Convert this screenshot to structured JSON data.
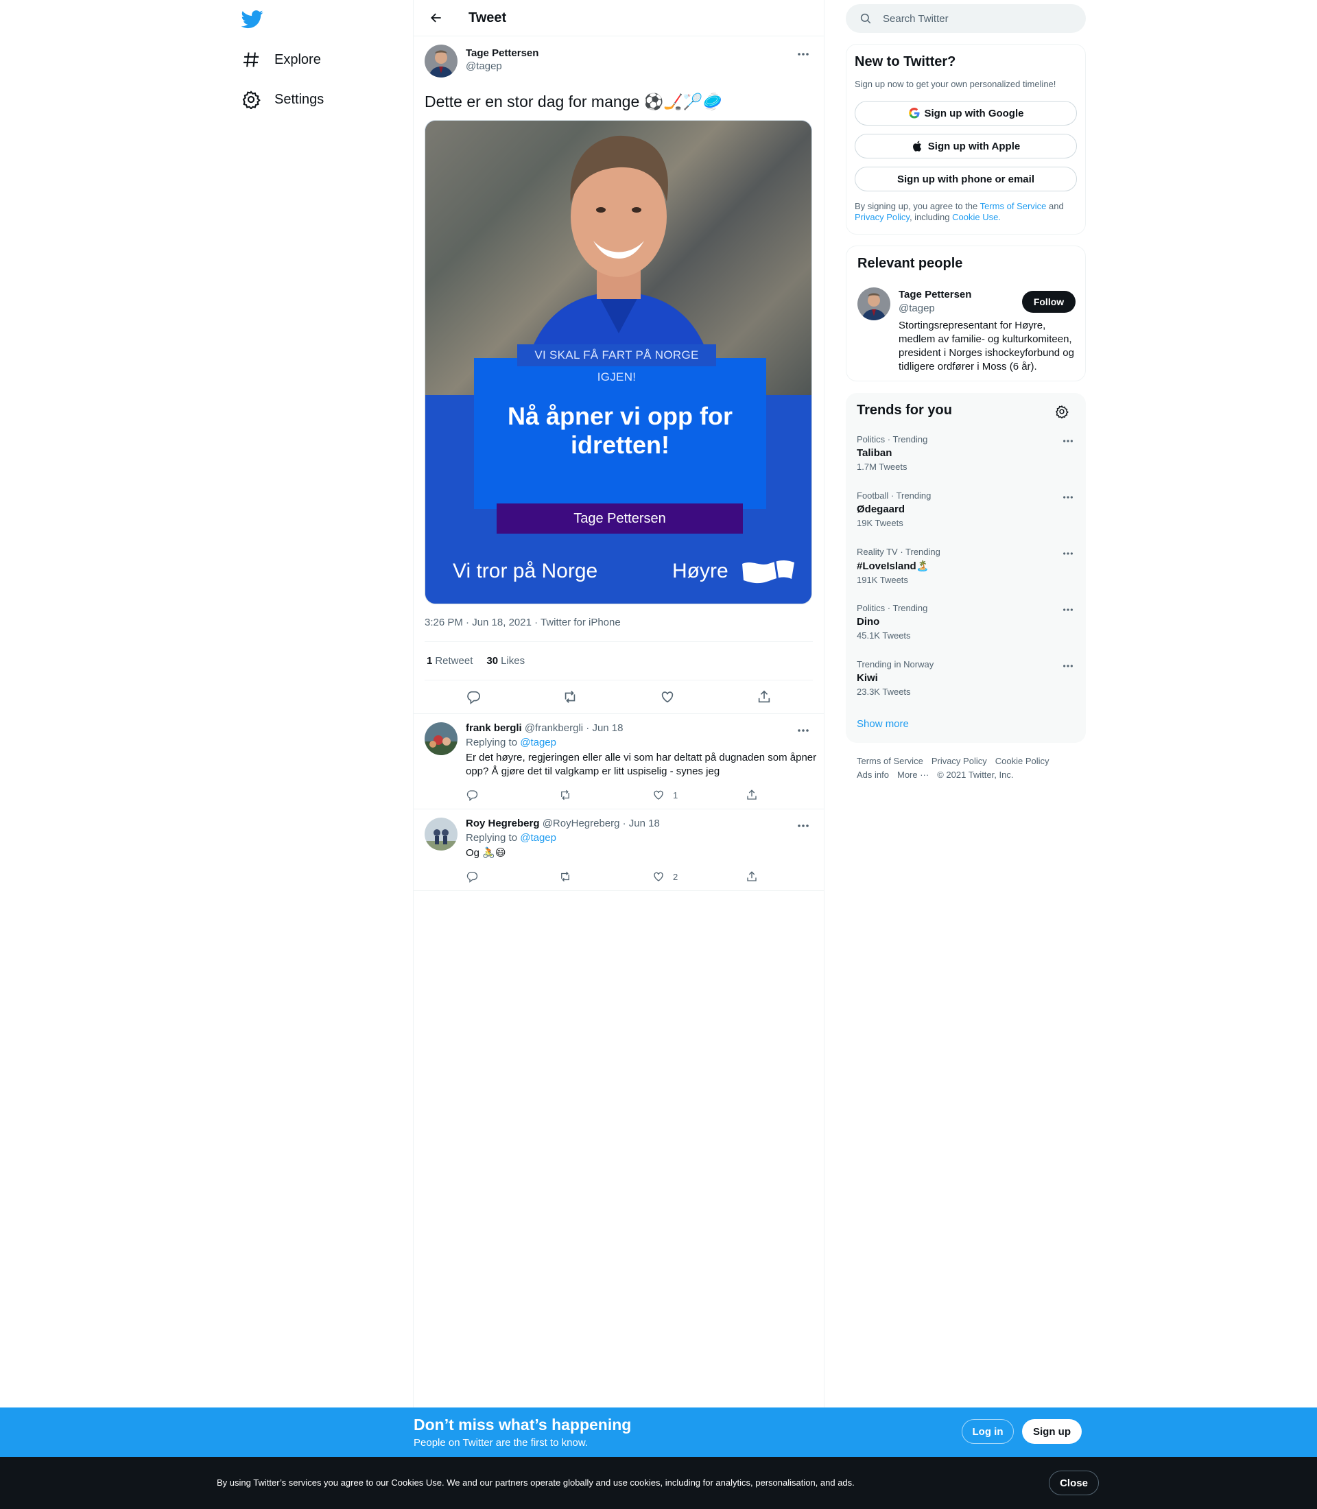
{
  "nav": {
    "items": [
      {
        "label": "Explore",
        "icon": "hashtag-icon"
      },
      {
        "label": "Settings",
        "icon": "gear-icon"
      }
    ]
  },
  "main": {
    "header_title": "Tweet",
    "tweet": {
      "author_name": "Tage Pettersen",
      "author_handle": "@tagep",
      "text": "Dette er en stor dag for mange ⚽🏒🏸🥏",
      "image": {
        "slogan": "VI SKAL FÅ FART PÅ NORGE IGJEN!",
        "headline": "Nå åpner vi opp for idretten!",
        "name_bar": "Tage Pettersen",
        "tagline": "Vi tror på Norge",
        "party": "Høyre"
      },
      "meta": "3:26 PM · Jun 18, 2021 · Twitter for iPhone",
      "retweets_count": "1",
      "retweets_label": "Retweet",
      "likes_count": "30",
      "likes_label": "Likes"
    },
    "replies": [
      {
        "name": "frank bergli",
        "handle_date": "@frankbergli · Jun 18",
        "replying_label": "Replying to",
        "replying_to": "@tagep",
        "text": "Er det høyre, regjeringen eller alle vi som har deltatt på dugnaden som åpner opp? Å gjøre det til valgkamp er litt uspiselig - synes jeg",
        "likes": "1"
      },
      {
        "name": "Roy Hegreberg",
        "handle_date": "@RoyHegreberg · Jun 18",
        "replying_label": "Replying to",
        "replying_to": "@tagep",
        "text": "Og 🚴😄",
        "likes": "2"
      }
    ]
  },
  "right": {
    "search_placeholder": "Search Twitter",
    "new_to_twitter": {
      "title": "New to Twitter?",
      "subtitle": "Sign up now to get your own personalized timeline!",
      "google_btn": "Sign up with Google",
      "apple_btn": "Sign up with Apple",
      "phone_btn": "Sign up with phone or email",
      "legal_1": "By signing up, you agree to the ",
      "terms": "Terms of Service",
      "legal_2": " and ",
      "privacy": "Privacy Policy",
      "legal_3": ", including ",
      "cookie": "Cookie Use.",
      "legal_4": ""
    },
    "relevant": {
      "title": "Relevant people",
      "name": "Tage Pettersen",
      "handle": "@tagep",
      "follow": "Follow",
      "bio": "Stortingsrepresentant for Høyre, medlem av familie- og kulturkomiteen, president i Norges ishockeyforbund og tidligere ordfører i Moss (6 år)."
    },
    "trends": {
      "title": "Trends for you",
      "items": [
        {
          "category": "Politics · Trending",
          "name": "Taliban",
          "count": "1.7M Tweets"
        },
        {
          "category": "Football · Trending",
          "name": "Ødegaard",
          "count": "19K Tweets"
        },
        {
          "category": "Reality TV · Trending",
          "name": "#LoveIsland🏝️",
          "count": "191K Tweets"
        },
        {
          "category": "Politics · Trending",
          "name": "Dino",
          "count": "45.1K Tweets"
        },
        {
          "category": "Trending in Norway",
          "name": "Kiwi",
          "count": "23.3K Tweets"
        }
      ],
      "show_more": "Show more"
    },
    "footer": {
      "terms": "Terms of Service",
      "privacy": "Privacy Policy",
      "cookie": "Cookie Policy",
      "ads": "Ads info",
      "more": "More ···",
      "copyright": "© 2021 Twitter, Inc."
    }
  },
  "signup_bar": {
    "title": "Don’t miss what’s happening",
    "subtitle": "People on Twitter are the first to know.",
    "login": "Log in",
    "signup": "Sign up"
  },
  "cookie_bar": {
    "text": "By using Twitter’s services you agree to our Cookies Use. We and our partners operate globally and use cookies, including for analytics, personalisation, and ads.",
    "close": "Close"
  },
  "colors": {
    "brand": "#1d9bf0",
    "text": "#0f1419",
    "muted": "#536471",
    "hoyre_blue": "#1d52c9",
    "hoyre_purple": "#3d0b80"
  }
}
